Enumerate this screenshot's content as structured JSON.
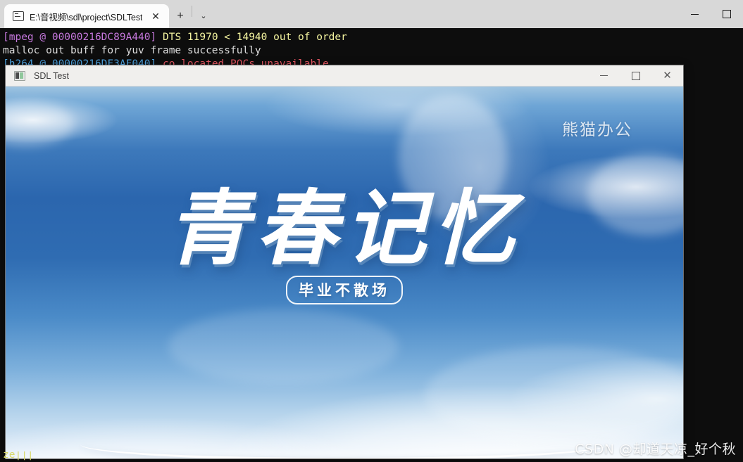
{
  "terminal": {
    "tab": {
      "title": "E:\\音视频\\sdl\\project\\SDLTest",
      "close_label": "✕",
      "favicon_name": "console-icon"
    },
    "new_tab_label": "+",
    "dropdown_label": "⌄",
    "window_controls": {
      "minimize": "",
      "maximize": ""
    },
    "console_lines": [
      {
        "segments": [
          {
            "text": "[mpeg @ 00000216DC89A440] ",
            "color": "magenta"
          },
          {
            "text": "DTS 11970 < 14940 out of order",
            "color": "yellow"
          }
        ]
      },
      {
        "segments": [
          {
            "text": "malloc out buff for yuv frame successfully",
            "color": "white"
          }
        ]
      },
      {
        "segments": [
          {
            "text": "[h264 @ 00000216DF3AF040] ",
            "color": "blue"
          },
          {
            "text": "co located POCs unavailable",
            "color": "red"
          }
        ]
      }
    ],
    "bottom_line": "ze|||"
  },
  "sdl_window": {
    "title": "SDL Test",
    "icon_name": "sdl-app-icon",
    "window_controls": {
      "minimize": "",
      "maximize": "",
      "close": "✕"
    },
    "video": {
      "watermark_top": "熊猫办公",
      "main_title": "青春记忆",
      "sub_title": "毕业不散场"
    }
  },
  "overlay": {
    "csdn_watermark": "CSDN @却道天凉_好个秋"
  },
  "colors": {
    "terminal_bg": "#0d0d0d",
    "titlebar_bg": "#d8d8d8",
    "tab_active_bg": "#fcfcfc",
    "sdl_titlebar_bg": "#f0efed",
    "console_magenta": "#c678dd",
    "console_yellow": "#f5f5a0",
    "console_white": "#dcdcdc",
    "console_blue": "#4ea3e0",
    "console_red": "#e05561",
    "sky_blue": "#2b66ae"
  }
}
